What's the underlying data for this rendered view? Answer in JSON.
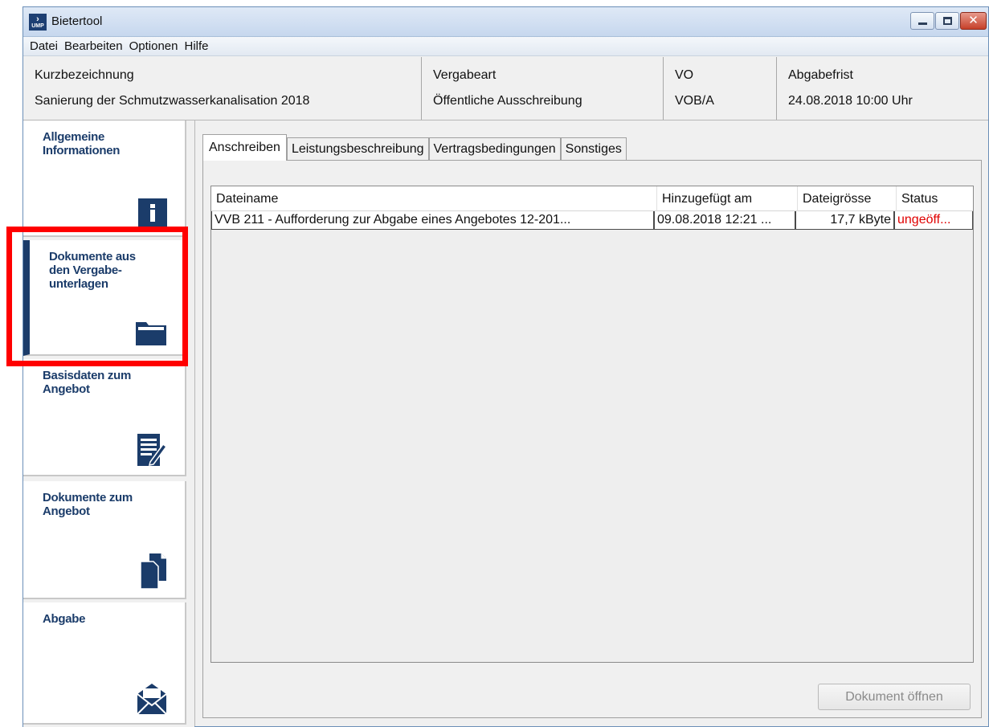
{
  "window": {
    "title": "Bietertool",
    "logo_text": "UMP"
  },
  "window_controls": {
    "close_glyph": "✕"
  },
  "menu": {
    "items": [
      "Datei",
      "Bearbeiten",
      "Optionen",
      "Hilfe"
    ]
  },
  "info": {
    "kurzbezeichnung_label": "Kurzbezeichnung",
    "kurzbezeichnung_value": "Sanierung der Schmutzwasserkanalisation 2018",
    "vergabeart_label": "Vergabeart",
    "vergabeart_value": "Öffentliche Ausschreibung",
    "vo_label": "VO",
    "vo_value": "VOB/A",
    "abgabefrist_label": "Abgabefrist",
    "abgabefrist_value": "24.08.2018 10:00 Uhr"
  },
  "sidebar": {
    "items": [
      {
        "label": "Allgemeine\nInformationen",
        "icon": "info-icon"
      },
      {
        "label": "Dokumente aus\nden Vergabe-\nunterlagen",
        "icon": "folder-icon",
        "selected": true
      },
      {
        "label": "Basisdaten zum\nAngebot",
        "icon": "edit-document-icon"
      },
      {
        "label": "Dokumente zum\nAngebot",
        "icon": "documents-icon"
      },
      {
        "label": "Abgabe",
        "icon": "envelope-icon"
      }
    ]
  },
  "tabs": [
    "Anschreiben",
    "Leistungsbeschreibung",
    "Vertragsbedingungen",
    "Sonstiges"
  ],
  "table": {
    "headers": [
      "Dateiname",
      "Hinzugefügt am",
      "Dateigrösse",
      "Status"
    ],
    "rows": [
      {
        "name": "VVB 211 - Aufforderung zur Abgabe eines Angebotes 12-201...",
        "date": "09.08.2018 12:21 ...",
        "size": "17,7 kByte",
        "status": "ungeöff..."
      }
    ]
  },
  "buttons": {
    "open_document": "Dokument öffnen"
  },
  "colors": {
    "accent": "#1b3c6a",
    "highlight": "#ff0000",
    "status_unopened": "#e00000"
  }
}
